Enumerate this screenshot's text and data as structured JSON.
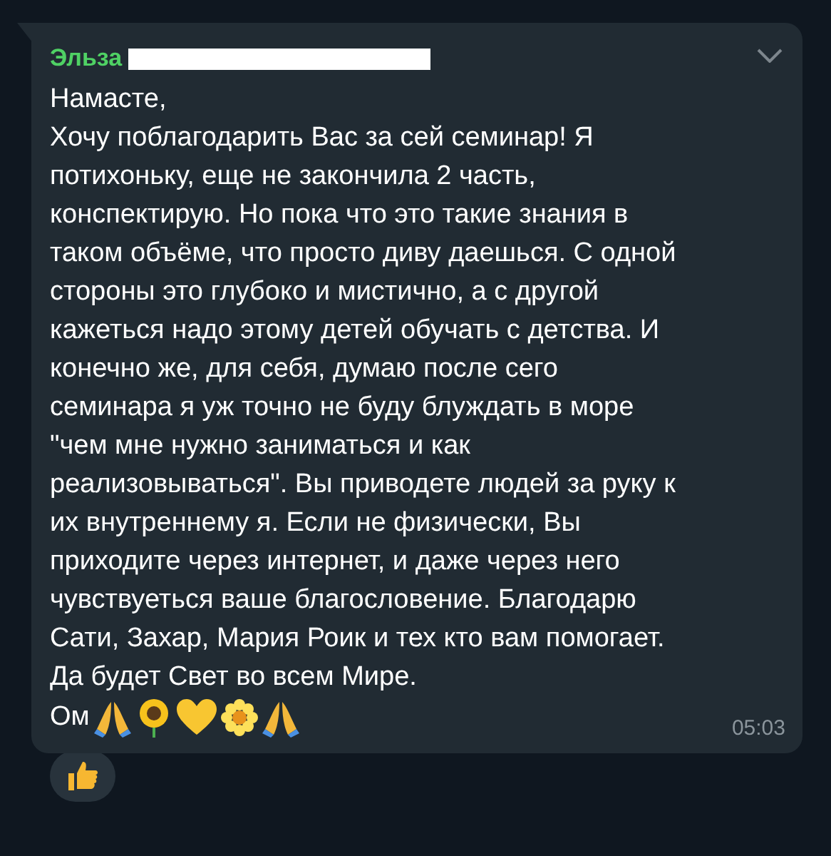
{
  "message": {
    "sender": "Эльза",
    "text": "Намасте,\nХочу поблагодарить Вас за сей семинар! Я\nпотихоньку, еще не закончила 2 часть,\nконспектирую. Но пока что это такие знания в\nтаком объёме, что просто диву даешься. С одной\nстороны это глубоко и мистично, а с другой\nкажеться надо этому детей обучать с детства. И\nконечно же, для себя, думаю после сего\nсеминара я уж точно не буду блуждать в море\n\"чем мне нужно заниматься и как\nреализовываться\". Вы приводете людей за руку к\nих внутреннему я. Если не физически, Вы\nприходите через интернет, и даже через него\nчувствуеться ваше благословение. Благодарю\nСати, Захар, Мария Роик и тех кто вам помогает.\nДа будет Свет во всем Мире.",
    "last_line": "Ом",
    "time": "05:03"
  }
}
